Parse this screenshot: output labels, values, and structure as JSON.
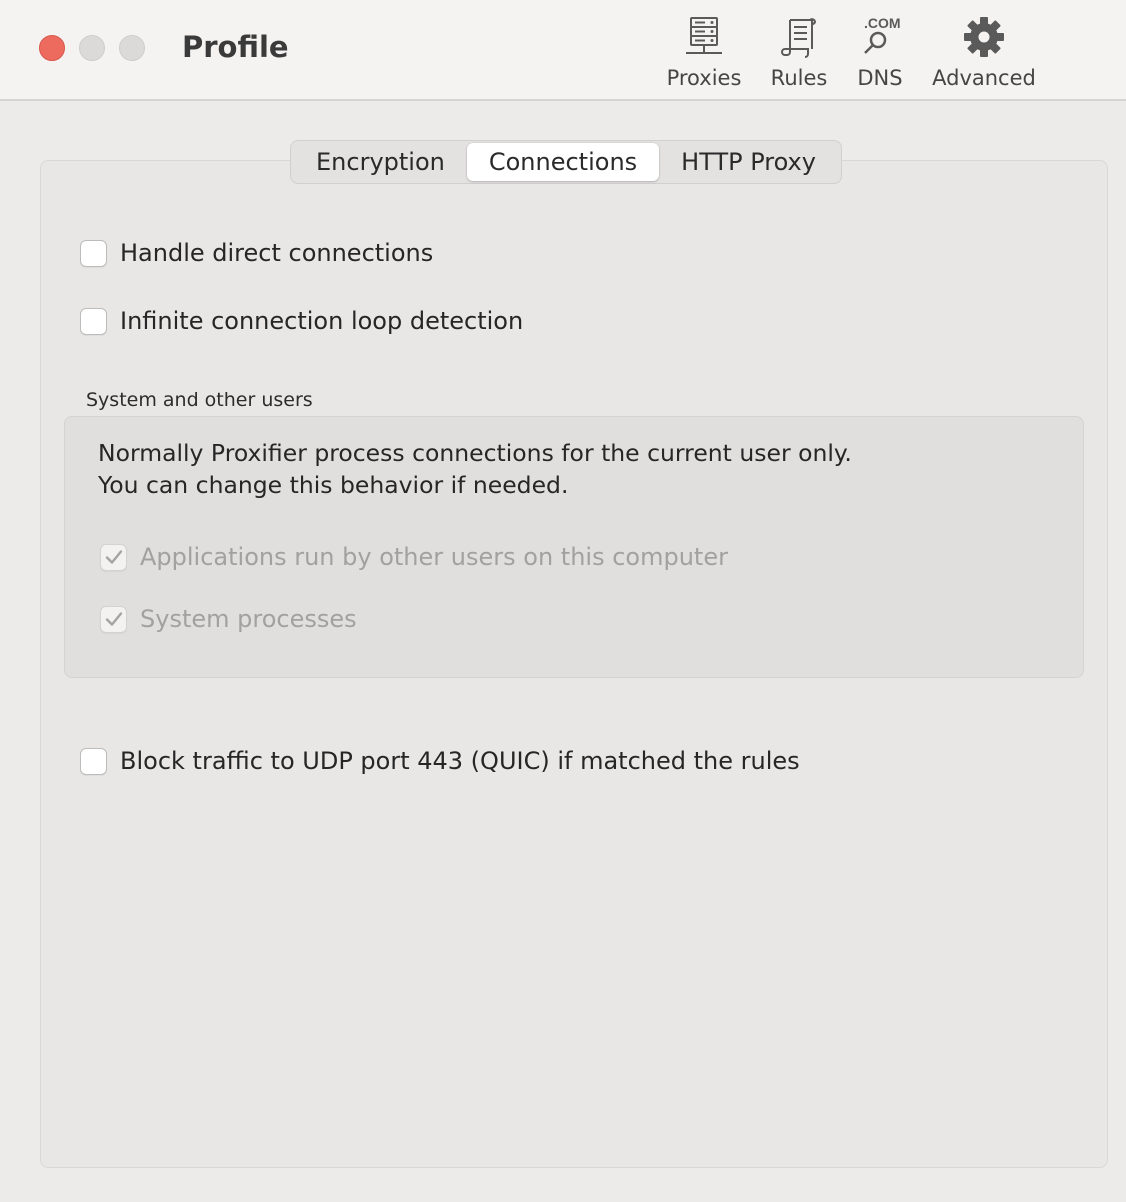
{
  "window": {
    "title": "Profile"
  },
  "toolbar": {
    "items": [
      {
        "label": "Proxies",
        "icon": "server-rack-icon"
      },
      {
        "label": "Rules",
        "icon": "scroll-document-icon"
      },
      {
        "label": "DNS",
        "icon": "dns-magnifier-icon",
        "icon_text": ".COM"
      },
      {
        "label": "Advanced",
        "icon": "gear-icon"
      }
    ]
  },
  "tabs": {
    "items": [
      "Encryption",
      "Connections",
      "HTTP Proxy"
    ],
    "selected": "Connections"
  },
  "options": {
    "handle_direct": {
      "label": "Handle direct connections",
      "checked": false
    },
    "loop_detection": {
      "label": "Infinite connection loop detection",
      "checked": false
    },
    "block_quic": {
      "label": "Block traffic to UDP port 443 (QUIC) if matched the rules",
      "checked": false
    }
  },
  "system_group": {
    "title": "System and other users",
    "description": "Normally Proxifier process connections for the current user only. You can change this behavior if needed.",
    "other_users": {
      "label": "Applications run by other users on this computer",
      "checked": true,
      "enabled": false
    },
    "system_processes": {
      "label": "System processes",
      "checked": true,
      "enabled": false
    }
  },
  "colors": {
    "close": "#ed6a5e",
    "window_bg": "#ecebea",
    "toolbar_bg": "#f5f3f2",
    "disabled_text": "#a2a1a0"
  }
}
